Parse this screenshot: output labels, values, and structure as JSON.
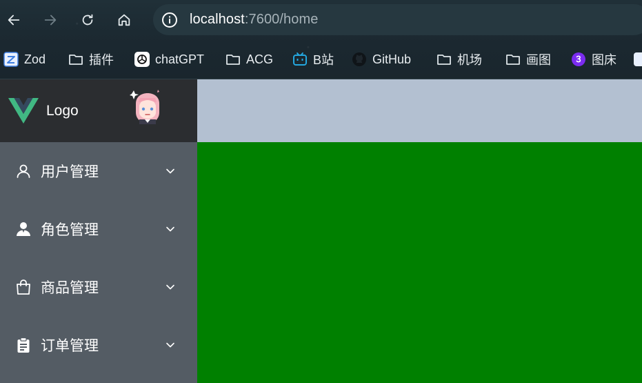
{
  "browser": {
    "url_host": "localhost",
    "url_rest": ":7600/home",
    "bookmarks": [
      {
        "label": "Zod",
        "icon": "zod-icon"
      },
      {
        "label": "插件",
        "icon": "folder-icon"
      },
      {
        "label": "chatGPT",
        "icon": "openai-icon"
      },
      {
        "label": "ACG",
        "icon": "folder-icon"
      },
      {
        "label": "B站",
        "icon": "bilibili-icon"
      },
      {
        "label": "GitHub",
        "icon": "github-icon"
      },
      {
        "label": "机场",
        "icon": "folder-icon"
      },
      {
        "label": "画图",
        "icon": "folder-icon"
      },
      {
        "label": "图床",
        "icon": "purple-circle-icon"
      }
    ]
  },
  "sidebar": {
    "logo_text": "Logo",
    "menu": [
      {
        "label": "用户管理",
        "icon": "user-icon"
      },
      {
        "label": "角色管理",
        "icon": "user-filled-icon"
      },
      {
        "label": "商品管理",
        "icon": "shopping-bag-icon"
      },
      {
        "label": "订单管理",
        "icon": "clipboard-icon"
      }
    ]
  },
  "colors": {
    "sidebar_bg": "#545c64",
    "logo_bg": "#2b2d30",
    "header_bg": "#b3c0d1",
    "main_bg": "#008000"
  }
}
